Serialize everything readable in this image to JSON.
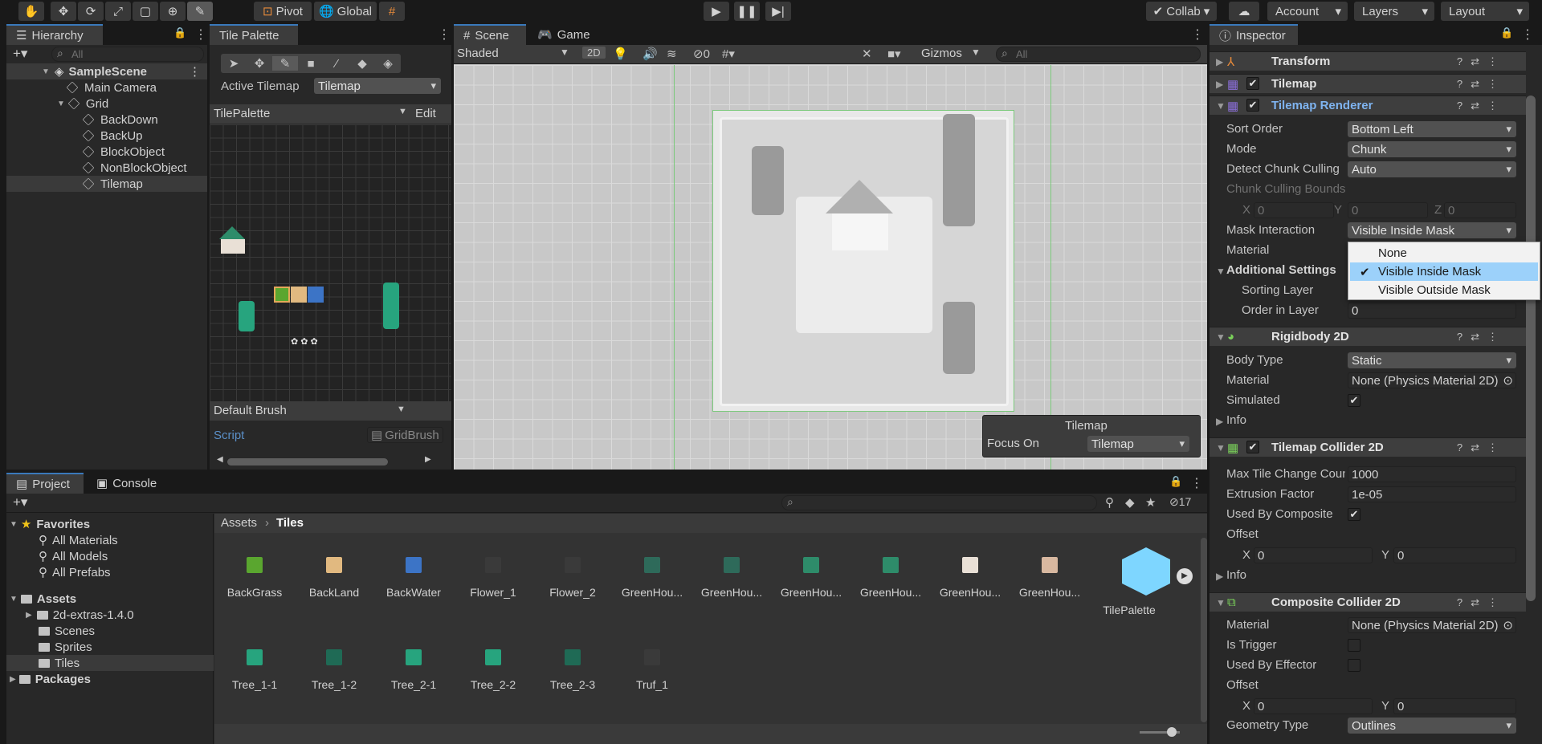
{
  "toolbar": {
    "pivot": "Pivot",
    "global": "Global",
    "collab": "Collab",
    "account": "Account",
    "layers": "Layers",
    "layout": "Layout"
  },
  "hierarchy": {
    "tab": "Hierarchy",
    "search_placeholder": "All",
    "items": [
      "SampleScene",
      "Main Camera",
      "Grid",
      "BackDown",
      "BackUp",
      "BlockObject",
      "NonBlockObject",
      "Tilemap"
    ]
  },
  "tile_palette": {
    "tab": "Tile Palette",
    "active_tilemap_label": "Active Tilemap",
    "active_tilemap_value": "Tilemap",
    "palette_value": "TilePalette",
    "edit": "Edit",
    "brush": "Default Brush",
    "script_label": "Script",
    "script_value": "GridBrush"
  },
  "scene": {
    "tab_scene": "Scene",
    "tab_game": "Game",
    "shading": "Shaded",
    "mode_2d": "2D",
    "hidden_count": "0",
    "gizmos": "Gizmos",
    "search_placeholder": "All",
    "overlay_title": "Tilemap",
    "focus_label": "Focus On",
    "focus_value": "Tilemap"
  },
  "inspector": {
    "tab": "Inspector",
    "components": {
      "transform": "Transform",
      "tilemap": "Tilemap",
      "tilemap_renderer": "Tilemap Renderer",
      "rigidbody": "Rigidbody 2D",
      "tilemap_collider": "Tilemap Collider 2D",
      "composite_collider": "Composite Collider 2D"
    },
    "renderer": {
      "sort_order_label": "Sort Order",
      "sort_order_value": "Bottom Left",
      "mode_label": "Mode",
      "mode_value": "Chunk",
      "detect_label": "Detect Chunk Culling",
      "detect_value": "Auto",
      "bounds_label": "Chunk Culling Bounds",
      "bx": "0",
      "by": "0",
      "bz": "0",
      "mask_label": "Mask Interaction",
      "mask_value": "Visible Inside Mask",
      "material_label": "Material",
      "additional": "Additional Settings",
      "sorting_layer_label": "Sorting Layer",
      "order_label": "Order in Layer",
      "order_value": "0"
    },
    "rigidbody": {
      "body_type_label": "Body Type",
      "body_type_value": "Static",
      "material_label": "Material",
      "material_value": "None (Physics Material 2D)",
      "simulated_label": "Simulated",
      "info": "Info"
    },
    "tilemap_collider": {
      "max_label": "Max Tile Change Count",
      "max_value": "1000",
      "extrusion_label": "Extrusion Factor",
      "extrusion_value": "1e-05",
      "composite_label": "Used By Composite",
      "offset_label": "Offset",
      "ox": "0",
      "oy": "0",
      "info": "Info"
    },
    "composite_collider": {
      "material_label": "Material",
      "material_value": "None (Physics Material 2D)",
      "trigger_label": "Is Trigger",
      "effector_label": "Used By Effector",
      "offset_label": "Offset",
      "ox": "0",
      "oy": "0",
      "geometry_label": "Geometry Type",
      "geometry_value": "Outlines"
    },
    "mask_menu": [
      "None",
      "Visible Inside Mask",
      "Visible Outside Mask"
    ]
  },
  "project": {
    "tab_project": "Project",
    "tab_console": "Console",
    "hidden_count": "17",
    "breadcrumb": [
      "Assets",
      "Tiles"
    ],
    "favorites": "Favorites",
    "fav_items": [
      "All Materials",
      "All Models",
      "All Prefabs"
    ],
    "assets": "Assets",
    "asset_folders": [
      "2d-extras-1.4.0",
      "Scenes",
      "Sprites",
      "Tiles"
    ],
    "packages": "Packages",
    "row1": [
      "BackGrass",
      "BackLand",
      "BackWater",
      "Flower_1",
      "Flower_2",
      "GreenHou...",
      "GreenHou...",
      "GreenHou...",
      "GreenHou...",
      "GreenHou...",
      "GreenHou...",
      "TilePalette"
    ],
    "row2": [
      "Tree_1-1",
      "Tree_1-2",
      "Tree_2-1",
      "Tree_2-2",
      "Tree_2-3",
      "Truf_1"
    ]
  }
}
